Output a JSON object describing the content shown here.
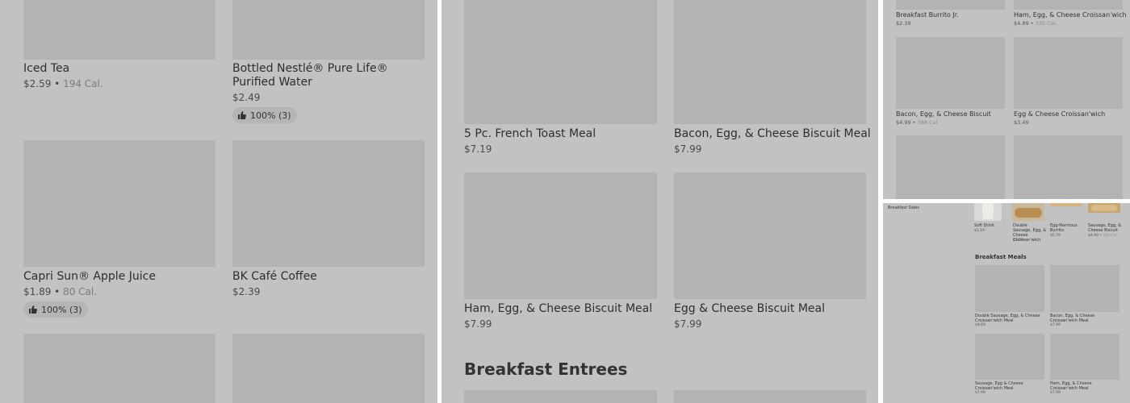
{
  "panel1": {
    "items": [
      {
        "name": "Iced Tea",
        "price": "$2.59",
        "cal": "194 Cal."
      },
      {
        "name": "Bottled Nestlé® Pure Life® Purified Water",
        "price": "$2.49",
        "rating": "100% (3)"
      },
      {
        "name": "Capri Sun® Apple Juice",
        "price": "$1.89",
        "cal": "80 Cal.",
        "rating": "100% (3)"
      },
      {
        "name": "BK Café Coffee",
        "price": "$2.39"
      }
    ]
  },
  "panel2": {
    "items": [
      {
        "name": "5 Pc. French Toast Meal",
        "price": "$7.19"
      },
      {
        "name": "Bacon, Egg, & Cheese Biscuit Meal",
        "price": "$7.99"
      },
      {
        "name": "Ham, Egg, & Cheese Biscuit Meal",
        "price": "$7.99"
      },
      {
        "name": "Egg & Cheese Biscuit Meal",
        "price": "$7.99"
      }
    ],
    "section_title": "Breakfast Entrees"
  },
  "panel3": {
    "items": [
      {
        "name": "Breakfast Burrito Jr.",
        "price": "$2.39"
      },
      {
        "name": "Ham, Egg, & Cheese Croissan'wich",
        "price": "$4.89",
        "cal": "335 Cal."
      },
      {
        "name": "Bacon, Egg, & Cheese Biscuit",
        "price": "$4.99",
        "cal": "388 Cal."
      },
      {
        "name": "Egg & Cheese Croissan'wich",
        "price": "$3.49"
      }
    ]
  },
  "panel4": {
    "sidebar_label": "Breakfast Sides",
    "top_items": [
      {
        "name": "Soft Drink",
        "price": "$1.19"
      },
      {
        "name": "Double Sausage, Egg, & Cheese Croissan'wich",
        "price": "$5.59"
      },
      {
        "name": "Egg-Normous Burrito",
        "price": "$5.79"
      },
      {
        "name": "Sausage, Egg, & Cheese Biscuit",
        "price": "$4.99",
        "cal": "520 Cal."
      }
    ],
    "section_title": "Breakfast Meals",
    "meal_items": [
      {
        "name": "Double Sausage, Egg, & Cheese Croissan'wich Meal",
        "price": "$8.69"
      },
      {
        "name": "Bacon, Egg, & Cheese Croissan'wich Meal",
        "price": "$7.99"
      },
      {
        "name": "Sausage, Egg & Cheese Croissan'wich Meal",
        "price": "$7.99"
      },
      {
        "name": "Ham, Egg, & Cheese Croissan'wich Meal",
        "price": "$7.99"
      }
    ]
  },
  "icons": {
    "rating": "thumbs-up-icon"
  },
  "colors": {
    "overlay": "#c2c2c2",
    "tile": "#b3b3b3"
  }
}
